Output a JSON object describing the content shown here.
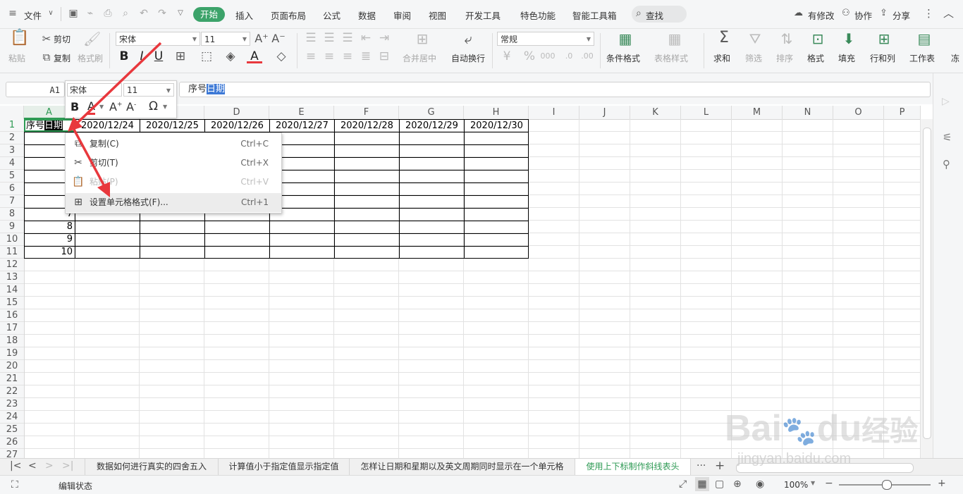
{
  "menubar": {
    "file_label": "文件",
    "tabs": [
      "开始",
      "插入",
      "页面布局",
      "公式",
      "数据",
      "审阅",
      "视图",
      "开发工具",
      "特色功能",
      "智能工具箱"
    ],
    "active_tab": "开始",
    "search_label": "查找",
    "right_actions": [
      "有修改",
      "协作",
      "分享"
    ]
  },
  "ribbon": {
    "paste": "粘贴",
    "cut": "剪切",
    "copy": "复制",
    "format_painter": "格式刷",
    "font_name": "宋体",
    "font_size": "11",
    "bold": "B",
    "italic": "I",
    "underline": "U",
    "merge_center": "合并居中",
    "wrap_text": "自动换行",
    "number_format": "常规",
    "cond_format": "条件格式",
    "table_style": "表格样式",
    "sum": "求和",
    "filter": "筛选",
    "sort": "排序",
    "format": "格式",
    "fill": "填充",
    "row_col": "行和列",
    "worksheet": "工作表",
    "freeze_cut": "冻"
  },
  "formula_bar": {
    "name_box": "A1",
    "prefix": "序号",
    "selected": "日期"
  },
  "mini_toolbar": {
    "font_name": "宋体",
    "font_size": "11",
    "bold": "B",
    "font_color": "A",
    "grow": "A",
    "shrink": "A",
    "symbol": "Ω"
  },
  "columns": [
    "A",
    "B",
    "C",
    "D",
    "E",
    "F",
    "G",
    "H",
    "I",
    "J",
    "K",
    "L",
    "M",
    "N",
    "O",
    "P"
  ],
  "active_column": "A",
  "rows": [
    "1",
    "2",
    "3",
    "4",
    "5",
    "6",
    "7",
    "8",
    "9",
    "10",
    "11",
    "12",
    "13",
    "14",
    "15",
    "16",
    "17",
    "18",
    "19",
    "20",
    "21",
    "22",
    "23",
    "24",
    "25",
    "26",
    "27"
  ],
  "cells": {
    "a1_prefix": "序号",
    "a1_selected": "日期",
    "dates": [
      "2020/12/24",
      "2020/12/25",
      "2020/12/26",
      "2020/12/27",
      "2020/12/28",
      "2020/12/29",
      "2020/12/30"
    ],
    "row_numbers": [
      "7",
      "8",
      "9",
      "10"
    ]
  },
  "context_menu": {
    "items": [
      {
        "label": "复制(C)",
        "shortcut": "Ctrl+C",
        "enabled": true,
        "highlighted": false
      },
      {
        "label": "剪切(T)",
        "shortcut": "Ctrl+X",
        "enabled": true,
        "highlighted": false
      },
      {
        "label": "粘贴(P)",
        "shortcut": "Ctrl+V",
        "enabled": false,
        "highlighted": false
      },
      {
        "label": "设置单元格格式(F)...",
        "shortcut": "Ctrl+1",
        "enabled": true,
        "highlighted": true
      }
    ]
  },
  "sheet_tabs": {
    "tabs": [
      "数据如何进行真实的四舍五入",
      "计算值小于指定值显示指定值",
      "怎样让日期和星期以及英文周期同时显示在一个单元格",
      "使用上下标制作斜线表头"
    ],
    "active": "使用上下标制作斜线表头",
    "more": "···",
    "add": "+"
  },
  "status": {
    "mode": "编辑状态",
    "zoom": "100%"
  },
  "watermark": {
    "brand": "Bai",
    "brand2": "du",
    "cn": "经验",
    "url": "jingyan.baidu.com"
  },
  "colors": {
    "accent_green": "#2e9a54",
    "arrow_red": "#e8383d",
    "selection_blue": "#3d79d6"
  }
}
